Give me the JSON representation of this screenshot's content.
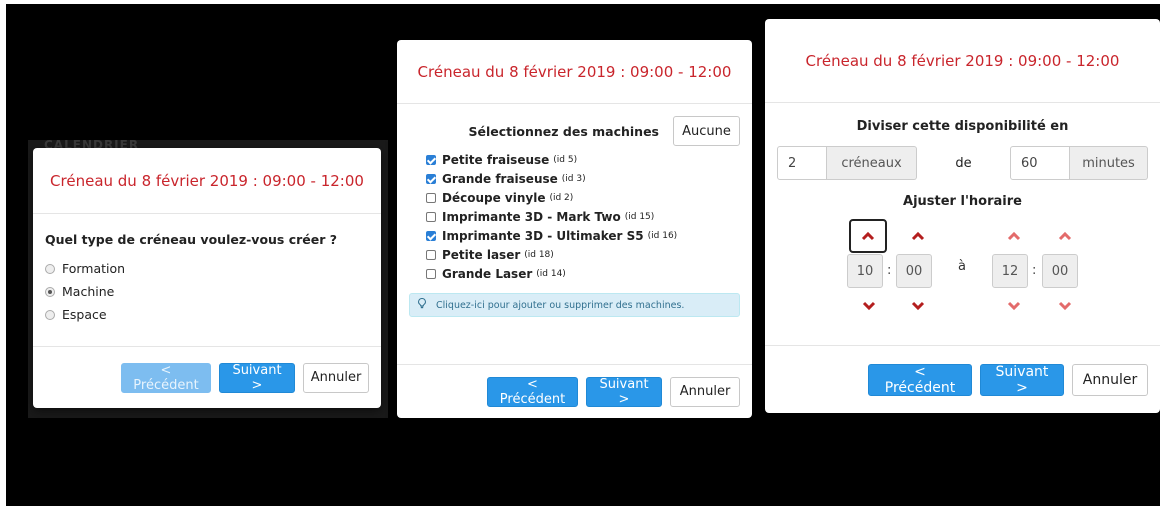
{
  "colors": {
    "title_red": "#c9252c",
    "primary_blue": "#2a97e8",
    "chevron_red": "#b41e1e",
    "chevron_dim": "#e36b6b"
  },
  "background_text": "CALENDRIER",
  "modal_type": {
    "title": "Créneau du 8 février 2019 : 09:00 - 12:00",
    "question": "Quel type de créneau voulez-vous créer ?",
    "options": [
      {
        "label": "Formation",
        "selected": false
      },
      {
        "label": "Machine",
        "selected": true
      },
      {
        "label": "Espace",
        "selected": false
      }
    ],
    "footer": {
      "prev": "< Précédent",
      "next": "Suivant >",
      "cancel": "Annuler"
    }
  },
  "modal_machines": {
    "title": "Créneau du 8 février 2019 : 09:00 - 12:00",
    "select_label": "Sélectionnez des machines",
    "none_button": "Aucune",
    "machines": [
      {
        "name": "Petite fraiseuse",
        "id": "(id 5)",
        "checked": true
      },
      {
        "name": "Grande fraiseuse",
        "id": "(id 3)",
        "checked": true
      },
      {
        "name": "Découpe vinyle",
        "id": "(id 2)",
        "checked": false
      },
      {
        "name": "Imprimante 3D - Mark Two",
        "id": "(id 15)",
        "checked": false
      },
      {
        "name": "Imprimante 3D - Ultimaker S5",
        "id": "(id 16)",
        "checked": true
      },
      {
        "name": "Petite laser",
        "id": "(id 18)",
        "checked": false
      },
      {
        "name": "Grande Laser",
        "id": "(id 14)",
        "checked": false
      }
    ],
    "info_icon": "lightbulb-icon",
    "info_text": "Cliquez-ici pour ajouter ou supprimer des machines.",
    "footer": {
      "prev": "< Précédent",
      "next": "Suivant >",
      "cancel": "Annuler"
    }
  },
  "modal_split": {
    "title": "Créneau du 8 février 2019 : 09:00 - 12:00",
    "split_title": "Diviser cette disponibilité en",
    "slots_value": "2",
    "slots_unit": "créneaux",
    "de_label": "de",
    "minutes_value": "60",
    "minutes_unit": "minutes",
    "adjust_title": "Ajuster l'horaire",
    "start": {
      "hours": "10",
      "minutes": "00"
    },
    "a_label": "à",
    "end": {
      "hours": "12",
      "minutes": "00"
    },
    "colon": ":",
    "footer": {
      "prev": "< Précédent",
      "next": "Suivant >",
      "cancel": "Annuler"
    }
  }
}
